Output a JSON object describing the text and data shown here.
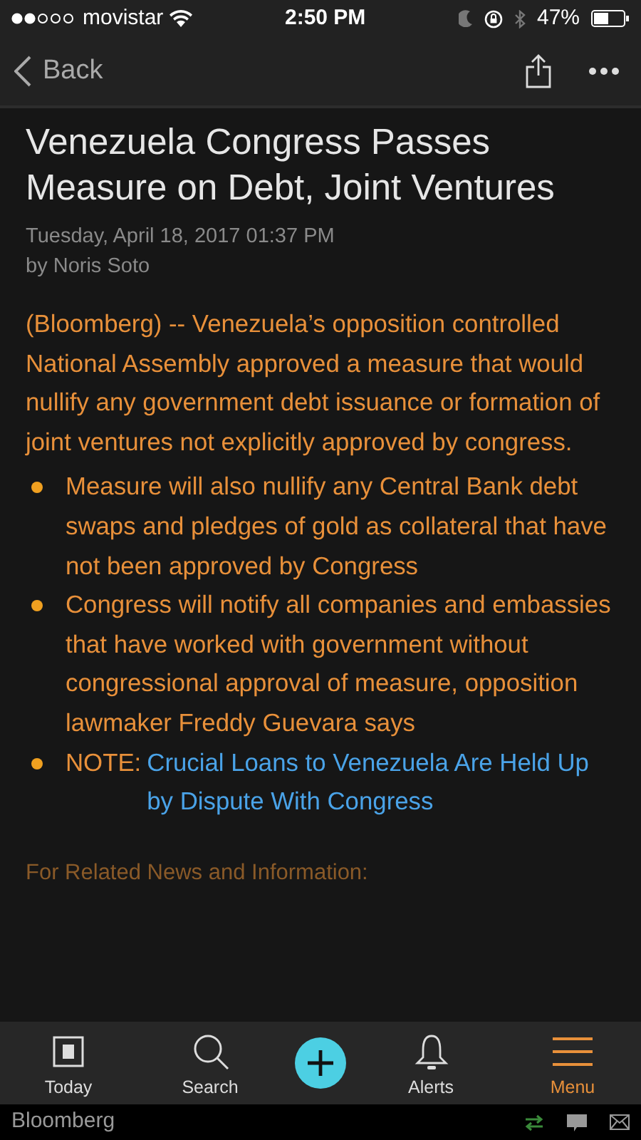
{
  "status_bar": {
    "carrier": "movistar",
    "time": "2:50 PM",
    "battery": "47%"
  },
  "nav": {
    "back": "Back"
  },
  "article": {
    "title": "Venezuela Congress Passes Measure on Debt, Joint Ventures",
    "date": "Tuesday, April 18, 2017 01:37 PM",
    "byline": "by Noris Soto",
    "lead": "(Bloomberg) -- Venezuela’s opposition controlled National Assembly approved a measure that would nullify any government debt issuance or formation of joint ventures not explicitly approved by congress.",
    "bullets": [
      {
        "kind": "text",
        "text": "Measure will also nullify any Central Bank debt swaps and pledges of gold as collateral that have not been approved by Congress"
      },
      {
        "kind": "text",
        "text": "Congress will notify all companies and embassies that have worked with government without congressional approval of measure, opposition lawmaker Freddy Guevara says"
      },
      {
        "kind": "link",
        "prefix": "NOTE:",
        "link": "Crucial Loans to Venezuela Are Held Up by Dispute With Congress"
      }
    ],
    "related": "For Related News and Information:"
  },
  "tab_bar": [
    {
      "kind": "today",
      "label": "Today",
      "selected": false
    },
    {
      "kind": "search",
      "label": "Search",
      "selected": false
    },
    {
      "kind": "add",
      "selected": false
    },
    {
      "kind": "alerts",
      "label": "Alerts",
      "selected": false
    },
    {
      "kind": "menu",
      "label": "Menu",
      "selected": true
    }
  ],
  "footer": {
    "brand": "Bloomberg"
  }
}
